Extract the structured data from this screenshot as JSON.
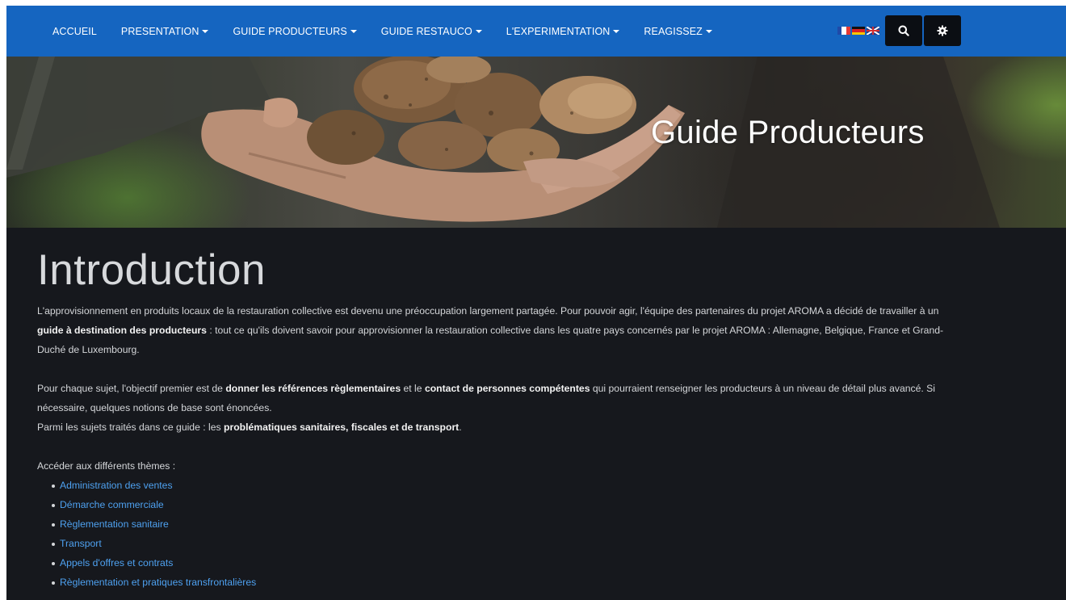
{
  "nav": {
    "items": [
      {
        "label": "ACCUEIL",
        "dropdown": false
      },
      {
        "label": "PRESENTATION",
        "dropdown": true
      },
      {
        "label": "GUIDE PRODUCTEURS",
        "dropdown": true
      },
      {
        "label": "GUIDE RESTAUCO",
        "dropdown": true
      },
      {
        "label": "L'EXPERIMENTATION",
        "dropdown": true
      },
      {
        "label": "REAGISSEZ",
        "dropdown": true
      }
    ],
    "flags": [
      "flag-fr",
      "flag-de",
      "flag-gb"
    ],
    "search_icon": "search-icon",
    "settings_icon": "gear-icon"
  },
  "hero": {
    "title": "Guide Producteurs"
  },
  "content": {
    "heading": "Introduction",
    "p1": {
      "t1": "L'approvisionnement en produits locaux de la restauration collective est devenu une préoccupation largement partagée. Pour pouvoir agir, l'équipe des partenaires du projet AROMA a décidé de travailler à un ",
      "b1": "guide à destination des producteurs",
      "t2": " : tout ce qu'ils doivent savoir pour approvisionner la restauration collective dans les quatre pays concernés par le projet AROMA : Allemagne, Belgique, France et Grand-Duché de Luxembourg."
    },
    "p2": {
      "t1": "Pour chaque sujet, l'objectif premier est de ",
      "b1": "donner les références règlementaires",
      "t2": " et le ",
      "b2": "contact de personnes compétentes",
      "t3": " qui pourraient renseigner les producteurs à un niveau de détail plus avancé. Si nécessaire, quelques notions de base sont énoncées."
    },
    "p3": {
      "t1": "Parmi les sujets traités dans ce guide : les ",
      "b1": "problématiques sanitaires, fiscales et de transport",
      "t2": "."
    },
    "themes_label": "Accéder aux différents thèmes :",
    "themes": [
      "Administration des ventes",
      "Démarche commerciale",
      "Règlementation sanitaire",
      "Transport",
      "Appels d'offres et contrats",
      "Règlementation et pratiques transfrontalières"
    ]
  },
  "colors": {
    "navbar": "#1565c0",
    "background": "#16181d",
    "link": "#4ea1f0"
  }
}
